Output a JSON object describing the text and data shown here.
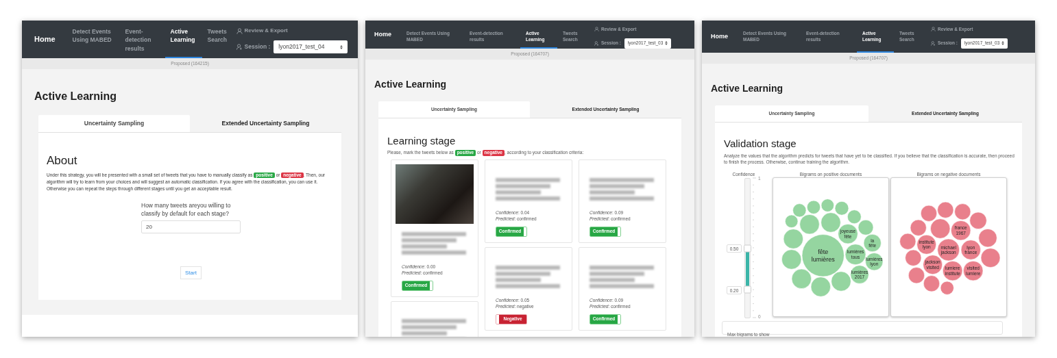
{
  "panels": [
    {
      "kind": "about",
      "nav": {
        "brand": "Home",
        "items": [
          {
            "label": "Detect Events Using MABED",
            "selected": false
          },
          {
            "label": "Event-detection results",
            "selected": false
          },
          {
            "label": "Active Learning",
            "selected": true
          },
          {
            "label": "Tweets Search",
            "selected": false
          }
        ],
        "review_link": "Review & Export",
        "session_label": "Session :",
        "session_value": "lyon2017_test_04"
      },
      "status": "Proposed (164215)",
      "heading": "Active Learning",
      "tabs": [
        {
          "label": "Uncertainty Sampling",
          "selected": true
        },
        {
          "label": "Extended Uncertainty Sampling",
          "selected": false
        }
      ],
      "section_title": "About",
      "description": [
        {
          "kind": "text",
          "text": "Under this strategy, you will be presented with a small set of tweets that you have to manually classify as "
        },
        {
          "kind": "badge",
          "text": "positive",
          "color": "#28a745"
        },
        {
          "kind": "text",
          "text": " or "
        },
        {
          "kind": "badge",
          "text": "negative",
          "color": "#dc3545"
        },
        {
          "kind": "text",
          "text": ". Then, our algorithm will try to learn from your choices and will suggest an automatic classification. If you agree with the classification, you can use it. Otherwise you can repeat the steps through different stages until you get an acceptable result."
        }
      ],
      "question": "How many tweets areyou willing to classify by default for each stage?",
      "answer": "20",
      "start_button": "Start"
    },
    {
      "kind": "learning",
      "nav": {
        "brand": "Home",
        "items": [
          {
            "label": "Detect Events Using MABED",
            "selected": false
          },
          {
            "label": "Event-detection results",
            "selected": false
          },
          {
            "label": "Active Learning",
            "selected": true
          },
          {
            "label": "Tweets Search",
            "selected": false
          }
        ],
        "review_link": "Review & Export",
        "session_label": "Session :",
        "session_value": "lyon2017_test_03"
      },
      "status": "Proposed (164707)",
      "heading": "Active Learning",
      "tabs": [
        {
          "label": "Uncertainty Sampling",
          "selected": true
        },
        {
          "label": "Extended Uncertainty Sampling",
          "selected": false
        }
      ],
      "section_title": "Learning stage",
      "description": [
        {
          "kind": "text",
          "text": "Please, mark the tweets below as "
        },
        {
          "kind": "badge",
          "text": "positive",
          "color": "#28a745"
        },
        {
          "kind": "text",
          "text": " or "
        },
        {
          "kind": "badge",
          "text": "negative",
          "color": "#dc3545"
        },
        {
          "kind": "text",
          "text": ", according to your classification criteria:"
        }
      ],
      "tweet_columns": [
        [
          {
            "has_image": true,
            "confidence": "*Confidence*: 0.00",
            "predicted": "*Predicted*: confirmed",
            "toggle": {
              "label": "Confirmed",
              "on": true
            }
          },
          {
            "has_image": false
          }
        ],
        [
          {
            "has_image": false,
            "confidence": "*Confidence*: 0.04",
            "predicted": "*Predicted*: confirmed",
            "toggle": {
              "label": "Confirmed",
              "on": true
            }
          },
          {
            "has_image": false,
            "confidence": "*Confidence*: 0.05",
            "predicted": "*Predicted*: negative",
            "toggle": {
              "label": "Negative",
              "on": false
            }
          }
        ],
        [
          {
            "has_image": false,
            "confidence": "*Confidence*: 0.09",
            "predicted": "*Predicted*: confirmed",
            "toggle": {
              "label": "Confirmed",
              "on": true
            }
          },
          {
            "has_image": false,
            "confidence": "*Confidence*: 0.09",
            "predicted": "*Predicted*: confirmed",
            "toggle": {
              "label": "Confirmed",
              "on": true
            }
          }
        ]
      ]
    },
    {
      "kind": "validation",
      "nav": {
        "brand": "Home",
        "items": [
          {
            "label": "Detect Events Using MABED",
            "selected": false
          },
          {
            "label": "Event-detection results",
            "selected": false
          },
          {
            "label": "Active Learning",
            "selected": true
          },
          {
            "label": "Tweets Search",
            "selected": false
          }
        ],
        "review_link": "Review & Export",
        "session_label": "Session :",
        "session_value": "lyon2017_test_03"
      },
      "status": "Proposed (164707)",
      "heading": "Active Learning",
      "tabs": [
        {
          "label": "Uncertainty Sampling",
          "selected": true
        },
        {
          "label": "Extended Uncertainty Sampling",
          "selected": false
        }
      ],
      "section_title": "Validation stage",
      "description": [
        {
          "kind": "text",
          "text": "Analyze the values that the algorithm predicts for tweets that have yet to be classified. If you believe that the classification is accurate, then proceed to finish the process. Otherwise, continue training the algorithm."
        }
      ],
      "confidence": {
        "title": "Confidence",
        "max_label": "1",
        "min_label": "0",
        "high": {
          "level": 0.5,
          "reading": "0.50"
        },
        "low": {
          "level": 0.2,
          "reading": "0.20"
        }
      },
      "positive_bigrams": {
        "title": "Bigrams on positive documents",
        "labels": [
          "joyeuse fête",
          "la fête",
          "fête lumières",
          "lumières tous",
          "lumières lyon",
          "lumières 2017"
        ]
      },
      "negative_bigrams": {
        "title": "Bigrams on negative documents",
        "labels": [
          "france 1967",
          "institute lyon",
          "michael jackson",
          "lyon france",
          "jackson visited",
          "lumiere institute",
          "visited lumiere"
        ]
      },
      "max_bigrams_label": "Max bigrams to show"
    }
  ]
}
